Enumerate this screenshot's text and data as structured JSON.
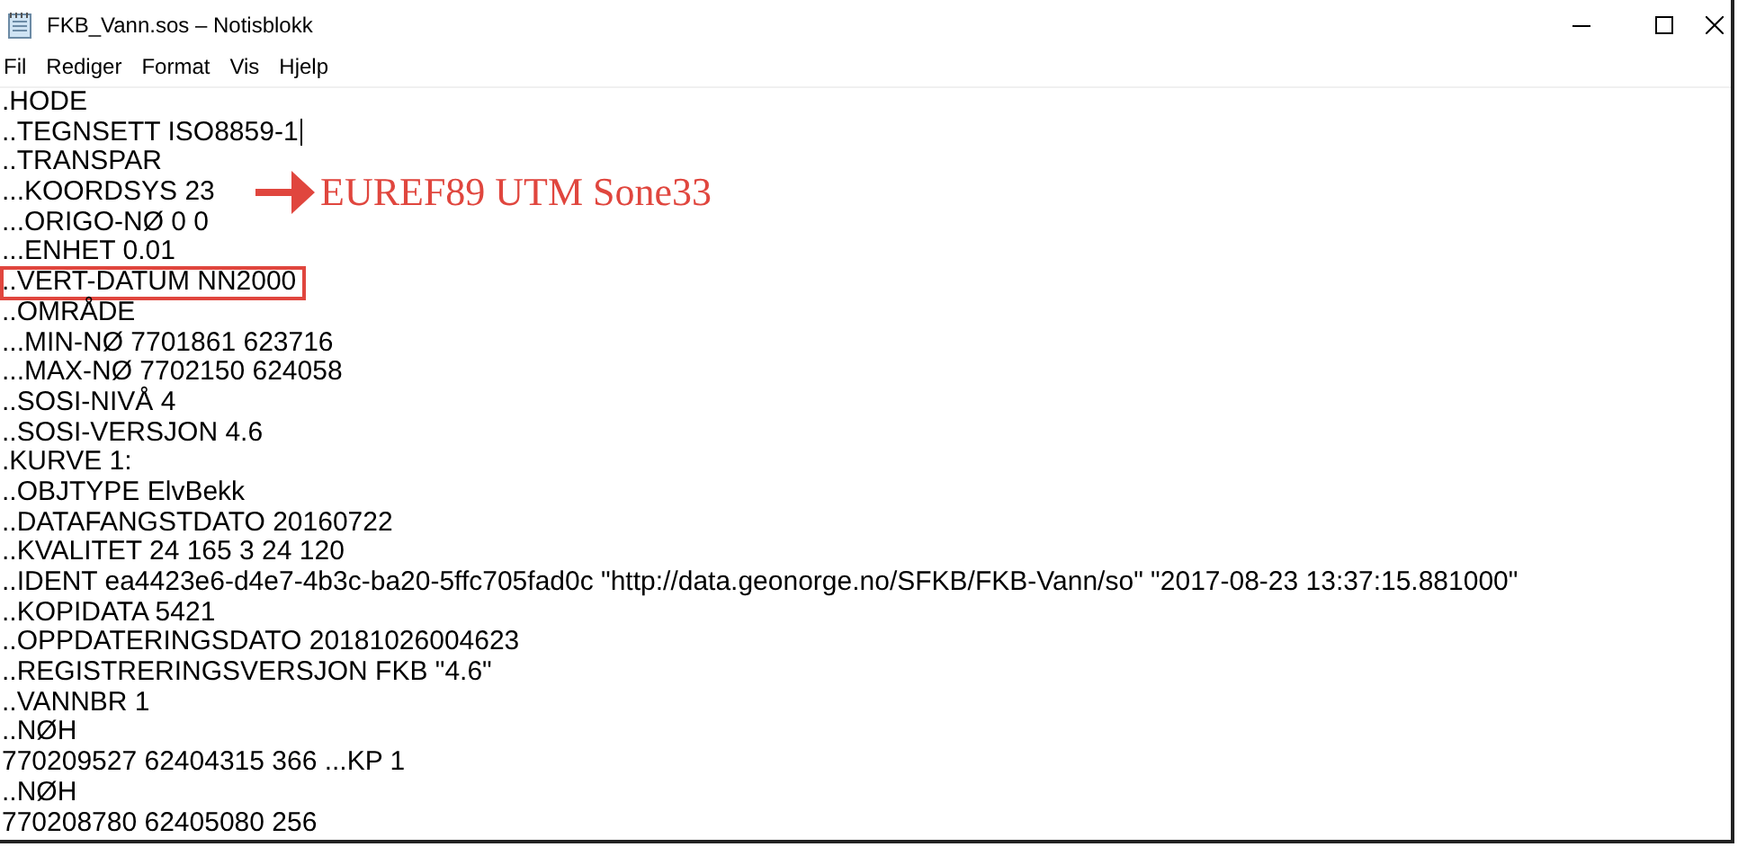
{
  "window": {
    "title": "FKB_Vann.sos – Notisblokk"
  },
  "menu": [
    "Fil",
    "Rediger",
    "Format",
    "Vis",
    "Hjelp"
  ],
  "lines": [
    {
      "text": ".HODE",
      "highlighted": false,
      "cursor": false
    },
    {
      "text": "..TEGNSETT ISO8859-1",
      "highlighted": false,
      "cursor": true
    },
    {
      "text": "..TRANSPAR",
      "highlighted": false,
      "cursor": false
    },
    {
      "text": "...KOORDSYS 23",
      "highlighted": false,
      "cursor": false,
      "annotation": "EUREF89 UTM Sone33"
    },
    {
      "text": "...ORIGO-NØ 0 0",
      "highlighted": false,
      "cursor": false
    },
    {
      "text": "...ENHET 0.01",
      "highlighted": false,
      "cursor": false
    },
    {
      "text": "..VERT-DATUM NN2000",
      "highlighted": true,
      "cursor": false
    },
    {
      "text": "..OMRÅDE",
      "highlighted": false,
      "cursor": false
    },
    {
      "text": "...MIN-NØ 7701861 623716",
      "highlighted": false,
      "cursor": false
    },
    {
      "text": "...MAX-NØ 7702150 624058",
      "highlighted": false,
      "cursor": false
    },
    {
      "text": "..SOSI-NIVÅ 4",
      "highlighted": false,
      "cursor": false
    },
    {
      "text": "..SOSI-VERSJON 4.6",
      "highlighted": false,
      "cursor": false
    },
    {
      "text": ".KURVE 1:",
      "highlighted": false,
      "cursor": false
    },
    {
      "text": "..OBJTYPE ElvBekk",
      "highlighted": false,
      "cursor": false
    },
    {
      "text": "..DATAFANGSTDATO 20160722",
      "highlighted": false,
      "cursor": false
    },
    {
      "text": "..KVALITET 24 165 3 24 120",
      "highlighted": false,
      "cursor": false
    },
    {
      "text": "..IDENT ea4423e6-d4e7-4b3c-ba20-5ffc705fad0c \"http://data.geonorge.no/SFKB/FKB-Vann/so\" \"2017-08-23 13:37:15.881000\"",
      "highlighted": false,
      "cursor": false
    },
    {
      "text": "..KOPIDATA 5421",
      "highlighted": false,
      "cursor": false
    },
    {
      "text": "..OPPDATERINGSDATO 20181026004623",
      "highlighted": false,
      "cursor": false
    },
    {
      "text": "..REGISTRERINGSVERSJON FKB \"4.6\"",
      "highlighted": false,
      "cursor": false
    },
    {
      "text": "..VANNBR 1",
      "highlighted": false,
      "cursor": false
    },
    {
      "text": "..NØH",
      "highlighted": false,
      "cursor": false
    },
    {
      "text": "770209527 62404315 366 ...KP 1",
      "highlighted": false,
      "cursor": false
    },
    {
      "text": "..NØH",
      "highlighted": false,
      "cursor": false
    },
    {
      "text": "770208780 62405080 256",
      "highlighted": false,
      "cursor": false
    }
  ]
}
